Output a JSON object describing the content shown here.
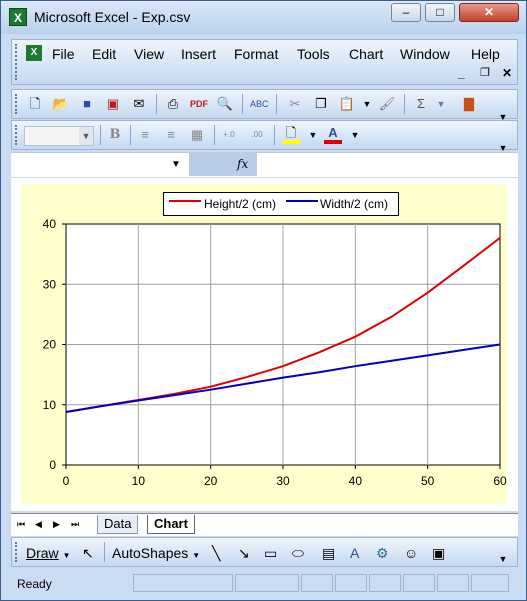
{
  "window": {
    "title": "Microsoft Excel - Exp.csv"
  },
  "menu": [
    "File",
    "Edit",
    "View",
    "Insert",
    "Format",
    "Tools",
    "Chart",
    "Window",
    "Help"
  ],
  "menu_underline": [
    "F",
    "E",
    "V",
    "I",
    "o",
    "T",
    "C",
    "W",
    "H"
  ],
  "formula_bar": {
    "fx_label": "fx",
    "name_box": "",
    "value": ""
  },
  "sheet_tabs": [
    "Data",
    "Chart"
  ],
  "active_tab": "Chart",
  "draw_toolbar": {
    "draw_label": "Draw",
    "autoshapes_label": "AutoShapes"
  },
  "status": {
    "text": "Ready"
  },
  "icons": [
    "new-icon",
    "open-icon",
    "save-icon",
    "permission-icon",
    "email-icon",
    "print-icon",
    "pdf-icon",
    "print-preview-icon",
    "spelling-icon",
    "cut-icon",
    "copy-icon",
    "paste-icon",
    "format-painter-icon",
    "autosum-icon",
    "chart-wizard-icon"
  ],
  "colors": {
    "series1": "#e00000",
    "series2": "#0000c0",
    "chart_area": "#ffffcc"
  },
  "chart_data": {
    "type": "line",
    "x": [
      0,
      5,
      10,
      15,
      20,
      25,
      30,
      35,
      40,
      45,
      50,
      55,
      60
    ],
    "series": [
      {
        "name": "Height/2 (cm)",
        "values": [
          8.8,
          9.8,
          10.8,
          11.8,
          13.0,
          14.6,
          16.4,
          18.7,
          21.3,
          24.6,
          28.6,
          33.1,
          37.7
        ]
      },
      {
        "name": "Width/2 (cm)",
        "values": [
          8.8,
          9.8,
          10.7,
          11.6,
          12.5,
          13.5,
          14.5,
          15.4,
          16.4,
          17.3,
          18.2,
          19.1,
          20.0
        ]
      }
    ],
    "xlim": [
      0,
      60
    ],
    "ylim": [
      0,
      40
    ],
    "xticks": [
      0,
      10,
      20,
      30,
      40,
      50,
      60
    ],
    "yticks": [
      0,
      10,
      20,
      30,
      40
    ],
    "title": "",
    "xlabel": "",
    "ylabel": "",
    "grid": true,
    "legend": "top"
  }
}
